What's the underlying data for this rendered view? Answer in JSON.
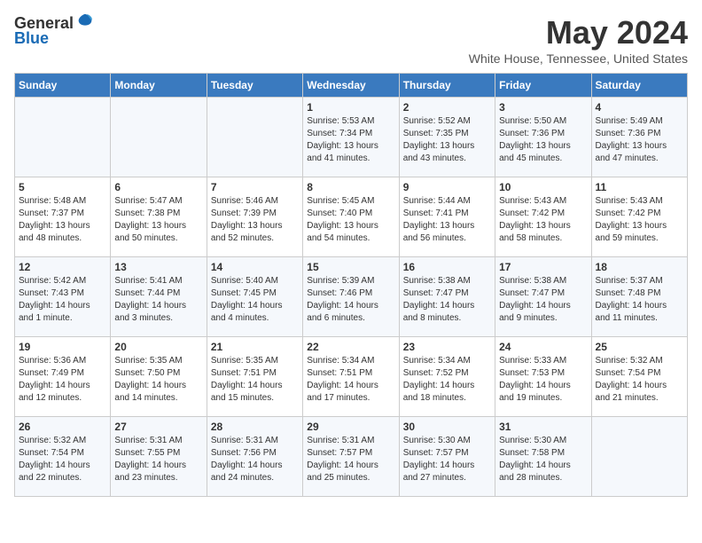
{
  "header": {
    "logo_general": "General",
    "logo_blue": "Blue",
    "month_year": "May 2024",
    "location": "White House, Tennessee, United States"
  },
  "days_of_week": [
    "Sunday",
    "Monday",
    "Tuesday",
    "Wednesday",
    "Thursday",
    "Friday",
    "Saturday"
  ],
  "weeks": [
    [
      {
        "day": "",
        "info": ""
      },
      {
        "day": "",
        "info": ""
      },
      {
        "day": "",
        "info": ""
      },
      {
        "day": "1",
        "info": "Sunrise: 5:53 AM\nSunset: 7:34 PM\nDaylight: 13 hours and 41 minutes."
      },
      {
        "day": "2",
        "info": "Sunrise: 5:52 AM\nSunset: 7:35 PM\nDaylight: 13 hours and 43 minutes."
      },
      {
        "day": "3",
        "info": "Sunrise: 5:50 AM\nSunset: 7:36 PM\nDaylight: 13 hours and 45 minutes."
      },
      {
        "day": "4",
        "info": "Sunrise: 5:49 AM\nSunset: 7:36 PM\nDaylight: 13 hours and 47 minutes."
      }
    ],
    [
      {
        "day": "5",
        "info": "Sunrise: 5:48 AM\nSunset: 7:37 PM\nDaylight: 13 hours and 48 minutes."
      },
      {
        "day": "6",
        "info": "Sunrise: 5:47 AM\nSunset: 7:38 PM\nDaylight: 13 hours and 50 minutes."
      },
      {
        "day": "7",
        "info": "Sunrise: 5:46 AM\nSunset: 7:39 PM\nDaylight: 13 hours and 52 minutes."
      },
      {
        "day": "8",
        "info": "Sunrise: 5:45 AM\nSunset: 7:40 PM\nDaylight: 13 hours and 54 minutes."
      },
      {
        "day": "9",
        "info": "Sunrise: 5:44 AM\nSunset: 7:41 PM\nDaylight: 13 hours and 56 minutes."
      },
      {
        "day": "10",
        "info": "Sunrise: 5:43 AM\nSunset: 7:42 PM\nDaylight: 13 hours and 58 minutes."
      },
      {
        "day": "11",
        "info": "Sunrise: 5:43 AM\nSunset: 7:42 PM\nDaylight: 13 hours and 59 minutes."
      }
    ],
    [
      {
        "day": "12",
        "info": "Sunrise: 5:42 AM\nSunset: 7:43 PM\nDaylight: 14 hours and 1 minute."
      },
      {
        "day": "13",
        "info": "Sunrise: 5:41 AM\nSunset: 7:44 PM\nDaylight: 14 hours and 3 minutes."
      },
      {
        "day": "14",
        "info": "Sunrise: 5:40 AM\nSunset: 7:45 PM\nDaylight: 14 hours and 4 minutes."
      },
      {
        "day": "15",
        "info": "Sunrise: 5:39 AM\nSunset: 7:46 PM\nDaylight: 14 hours and 6 minutes."
      },
      {
        "day": "16",
        "info": "Sunrise: 5:38 AM\nSunset: 7:47 PM\nDaylight: 14 hours and 8 minutes."
      },
      {
        "day": "17",
        "info": "Sunrise: 5:38 AM\nSunset: 7:47 PM\nDaylight: 14 hours and 9 minutes."
      },
      {
        "day": "18",
        "info": "Sunrise: 5:37 AM\nSunset: 7:48 PM\nDaylight: 14 hours and 11 minutes."
      }
    ],
    [
      {
        "day": "19",
        "info": "Sunrise: 5:36 AM\nSunset: 7:49 PM\nDaylight: 14 hours and 12 minutes."
      },
      {
        "day": "20",
        "info": "Sunrise: 5:35 AM\nSunset: 7:50 PM\nDaylight: 14 hours and 14 minutes."
      },
      {
        "day": "21",
        "info": "Sunrise: 5:35 AM\nSunset: 7:51 PM\nDaylight: 14 hours and 15 minutes."
      },
      {
        "day": "22",
        "info": "Sunrise: 5:34 AM\nSunset: 7:51 PM\nDaylight: 14 hours and 17 minutes."
      },
      {
        "day": "23",
        "info": "Sunrise: 5:34 AM\nSunset: 7:52 PM\nDaylight: 14 hours and 18 minutes."
      },
      {
        "day": "24",
        "info": "Sunrise: 5:33 AM\nSunset: 7:53 PM\nDaylight: 14 hours and 19 minutes."
      },
      {
        "day": "25",
        "info": "Sunrise: 5:32 AM\nSunset: 7:54 PM\nDaylight: 14 hours and 21 minutes."
      }
    ],
    [
      {
        "day": "26",
        "info": "Sunrise: 5:32 AM\nSunset: 7:54 PM\nDaylight: 14 hours and 22 minutes."
      },
      {
        "day": "27",
        "info": "Sunrise: 5:31 AM\nSunset: 7:55 PM\nDaylight: 14 hours and 23 minutes."
      },
      {
        "day": "28",
        "info": "Sunrise: 5:31 AM\nSunset: 7:56 PM\nDaylight: 14 hours and 24 minutes."
      },
      {
        "day": "29",
        "info": "Sunrise: 5:31 AM\nSunset: 7:57 PM\nDaylight: 14 hours and 25 minutes."
      },
      {
        "day": "30",
        "info": "Sunrise: 5:30 AM\nSunset: 7:57 PM\nDaylight: 14 hours and 27 minutes."
      },
      {
        "day": "31",
        "info": "Sunrise: 5:30 AM\nSunset: 7:58 PM\nDaylight: 14 hours and 28 minutes."
      },
      {
        "day": "",
        "info": ""
      }
    ]
  ]
}
